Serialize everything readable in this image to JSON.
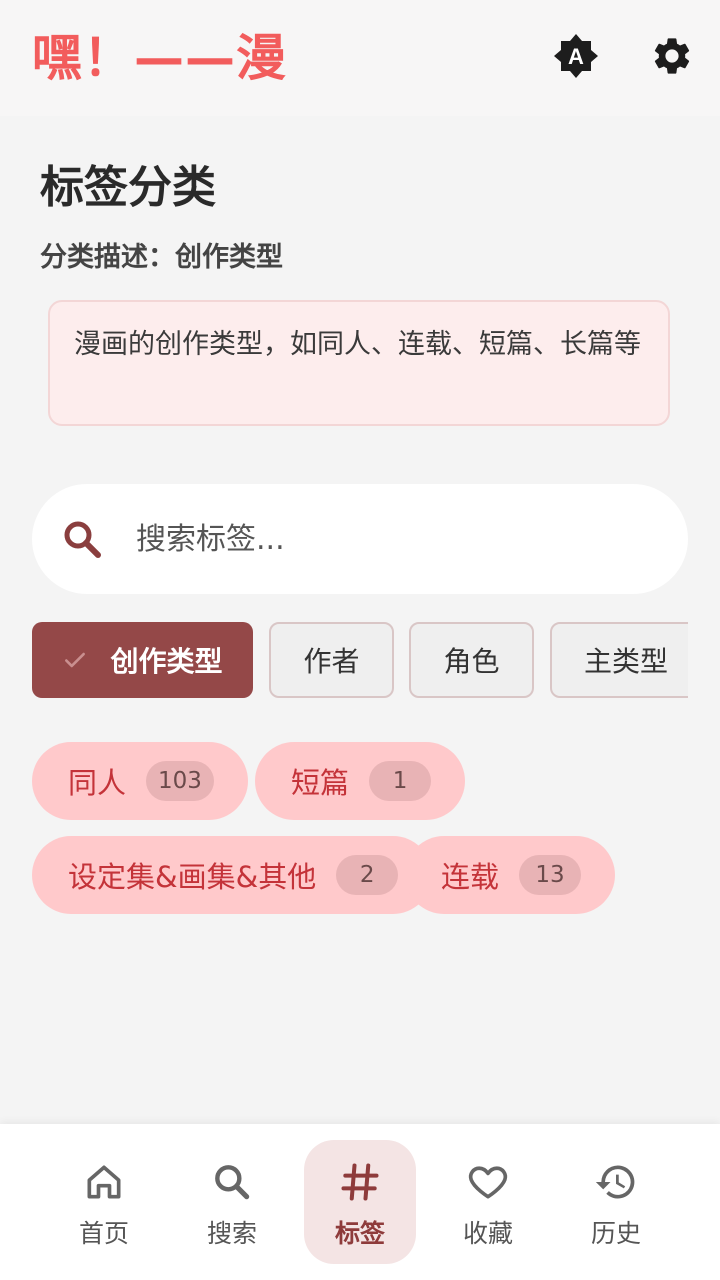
{
  "app": {
    "title": "嘿！——漫",
    "brand_color": "#f25c5c"
  },
  "header_icons": [
    "auto-theme-icon",
    "gear-icon"
  ],
  "page": {
    "title": "标签分类",
    "description_label": "分类描述：创作类型",
    "description_text": "漫画的创作类型，如同人、连载、短篇、长篇等"
  },
  "search": {
    "placeholder": "搜索标签..."
  },
  "categories": [
    {
      "label": "创作类型",
      "selected": true
    },
    {
      "label": "作者",
      "selected": false
    },
    {
      "label": "角色",
      "selected": false
    },
    {
      "label": "主类型",
      "selected": false
    }
  ],
  "tags": [
    {
      "label": "同人",
      "count": "103"
    },
    {
      "label": "短篇",
      "count": "1"
    },
    {
      "label": "设定集&画集&其他",
      "count": "2"
    },
    {
      "label": "连载",
      "count": "13"
    }
  ],
  "nav": [
    {
      "label": "首页",
      "icon": "home-icon",
      "active": false
    },
    {
      "label": "搜索",
      "icon": "search-icon",
      "active": false
    },
    {
      "label": "标签",
      "icon": "hash-icon",
      "active": true
    },
    {
      "label": "收藏",
      "icon": "heart-icon",
      "active": false
    },
    {
      "label": "历史",
      "icon": "history-icon",
      "active": false
    }
  ],
  "colors": {
    "selected_chip": "#944848",
    "tag_bg": "#ffc9cb",
    "tag_text": "#c43339",
    "desc_box_bg": "#fdeded"
  }
}
